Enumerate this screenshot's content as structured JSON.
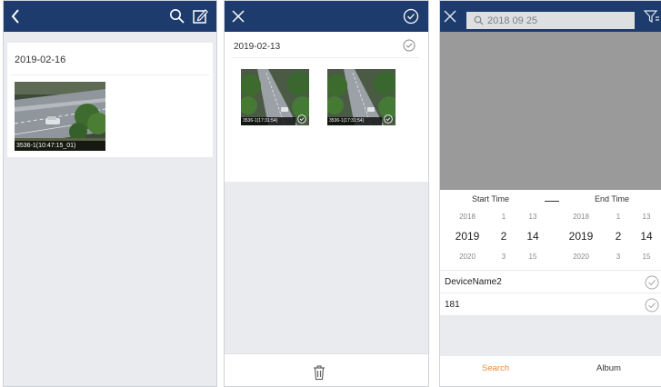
{
  "colors": {
    "navbar": "#1d3b6c",
    "accent_orange": "#f0883a",
    "page_bg": "#e9ebee",
    "overlay": "#9a9a9b",
    "search_field_bg": "#dedfe1"
  },
  "panel_list": {
    "nav": {
      "back_icon": "chevron-left-icon",
      "search_icon": "search-icon",
      "edit_icon": "edit-icon"
    },
    "date": "2019-02-16",
    "items": [
      {
        "caption": "3536-1(10:47:15_01)"
      }
    ]
  },
  "panel_select": {
    "nav": {
      "close_icon": "close-icon",
      "select_all_icon": "check-circle-icon"
    },
    "date": "2019-02-13",
    "items": [
      {
        "caption": "3536-1(17:31:54)"
      },
      {
        "caption": "3536-1(17:31:54)"
      }
    ],
    "bottom": {
      "delete_icon": "trash-icon"
    }
  },
  "panel_search": {
    "nav": {
      "close_icon": "close-icon",
      "filter_icon": "filter-icon"
    },
    "search": {
      "value": "2018 09 25"
    },
    "picker": {
      "start_label": "Start Time",
      "end_label": "End Time",
      "start": {
        "year": [
          "2018",
          "2019",
          "2020"
        ],
        "month": [
          "1",
          "2",
          "3"
        ],
        "day": [
          "13",
          "14",
          "15"
        ]
      },
      "end": {
        "year": [
          "2018",
          "2019",
          "2020"
        ],
        "month": [
          "1",
          "2",
          "3"
        ],
        "day": [
          "13",
          "14",
          "15"
        ]
      }
    },
    "devices": [
      {
        "name": "DeviceName2"
      },
      {
        "name": "181"
      }
    ],
    "tabs": {
      "search": "Search",
      "album": "Album"
    }
  }
}
